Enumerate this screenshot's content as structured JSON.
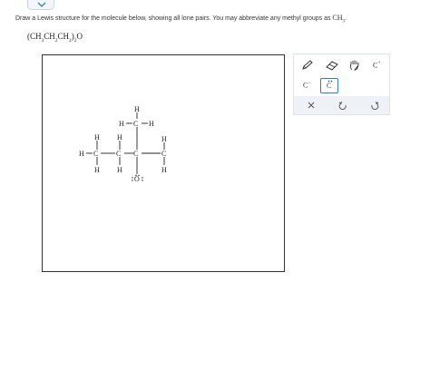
{
  "prompt": {
    "text_before": "Draw a Lewis structure for the molecule below, showing all lone pairs. You may abbreviate any methyl groups as ",
    "ch3_main": "CH",
    "ch3_sub": "3",
    "text_after": "."
  },
  "formula": {
    "open": "(CH",
    "sub1": "3",
    "mid1": "CH",
    "sub2": "2",
    "mid2": "CH",
    "sub3": "2",
    "close": ")",
    "sub4": "2",
    "atom": "O"
  },
  "molecule": {
    "atoms": {
      "h_top": "H",
      "h_left_upper": "H",
      "c_upper": "C",
      "h_right_upper": "H",
      "h_a_top": "H",
      "h_b_top": "H",
      "h_d_top": "H",
      "h_far_left": "H",
      "c_a": "C",
      "c_b": "C",
      "c_c": "C",
      "c_d": "C",
      "h_a_bottom": "H",
      "h_b_bottom": "H",
      "h_d_bottom": "H",
      "oxygen": "O"
    }
  },
  "toolbar": {
    "charge_minus": "−",
    "charge_plus": "+",
    "carbon_letter": "C",
    "carbon_letter_selected": "C",
    "carbon_letter_plus": "C"
  }
}
